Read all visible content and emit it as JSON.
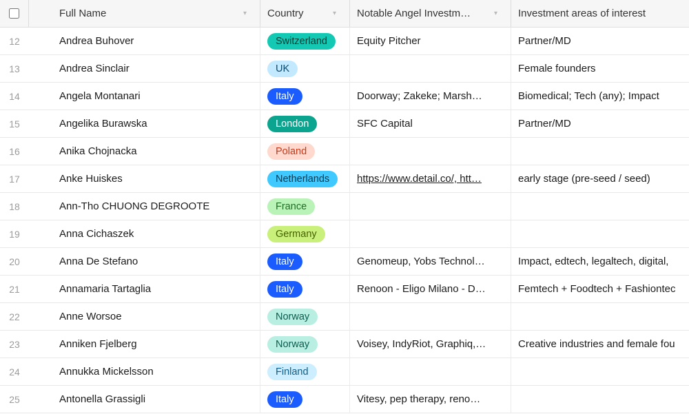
{
  "headers": {
    "fullName": "Full Name",
    "country": "Country",
    "investments": "Notable Angel Investm…",
    "interest": "Investment areas of interest"
  },
  "countryStyles": {
    "Switzerland": {
      "bg": "#14c9b3",
      "fg": "#053a33"
    },
    "UK": {
      "bg": "#c3e9ff",
      "fg": "#0b4a70"
    },
    "Italy": {
      "bg": "#1b5cff",
      "fg": "#ffffff"
    },
    "London": {
      "bg": "#0ba58f",
      "fg": "#ffffff"
    },
    "Poland": {
      "bg": "#ffd9cd",
      "fg": "#c73a1b"
    },
    "Netherlands": {
      "bg": "#3fc9ff",
      "fg": "#083b54"
    },
    "France": {
      "bg": "#b9f3b8",
      "fg": "#1f6f23"
    },
    "Germany": {
      "bg": "#c8f07a",
      "fg": "#476100"
    },
    "Norway": {
      "bg": "#b9efe2",
      "fg": "#0c5c4f"
    },
    "Finland": {
      "bg": "#cdeeff",
      "fg": "#0e5d8a"
    }
  },
  "rows": [
    {
      "num": 12,
      "name": "Andrea Buhover",
      "country": "Switzerland",
      "investments": "Equity Pitcher",
      "interest": "Partner/MD"
    },
    {
      "num": 13,
      "name": "Andrea Sinclair",
      "country": "UK",
      "investments": "",
      "interest": "Female founders"
    },
    {
      "num": 14,
      "name": "Angela Montanari",
      "country": "Italy",
      "investments": "Doorway; Zakeke; Marsh…",
      "interest": "Biomedical; Tech (any); Impact"
    },
    {
      "num": 15,
      "name": "Angelika Burawska",
      "country": "London",
      "investments": "SFC Capital",
      "interest": "Partner/MD"
    },
    {
      "num": 16,
      "name": "Anika Chojnacka",
      "country": "Poland",
      "investments": "",
      "interest": ""
    },
    {
      "num": 17,
      "name": "Anke Huiskes",
      "country": "Netherlands",
      "investments_html": true,
      "investments": "https://www.detail.co/, htt…",
      "interest": "early stage (pre-seed / seed)"
    },
    {
      "num": 18,
      "name": "Ann-Tho CHUONG DEGROOTE",
      "country": "France",
      "investments": "",
      "interest": ""
    },
    {
      "num": 19,
      "name": "Anna Cichaszek",
      "country": "Germany",
      "investments": "",
      "interest": ""
    },
    {
      "num": 20,
      "name": "Anna De Stefano",
      "country": "Italy",
      "investments": "Genomeup, Yobs Technol…",
      "interest": "Impact, edtech, legaltech, digital,"
    },
    {
      "num": 21,
      "name": "Annamaria Tartaglia",
      "country": "Italy",
      "investments": "Renoon - Eligo Milano - D…",
      "interest": "Femtech + Foodtech + Fashiontec"
    },
    {
      "num": 22,
      "name": "Anne Worsoe",
      "country": "Norway",
      "investments": "",
      "interest": ""
    },
    {
      "num": 23,
      "name": "Anniken Fjelberg",
      "country": "Norway",
      "investments": "Voisey, IndyRiot, Graphiq,…",
      "interest": "Creative industries and female fou"
    },
    {
      "num": 24,
      "name": "Annukka Mickelsson",
      "country": "Finland",
      "investments": "",
      "interest": ""
    },
    {
      "num": 25,
      "name": "Antonella Grassigli",
      "country": "Italy",
      "investments": "Vitesy, pep therapy, reno…",
      "interest": ""
    }
  ]
}
